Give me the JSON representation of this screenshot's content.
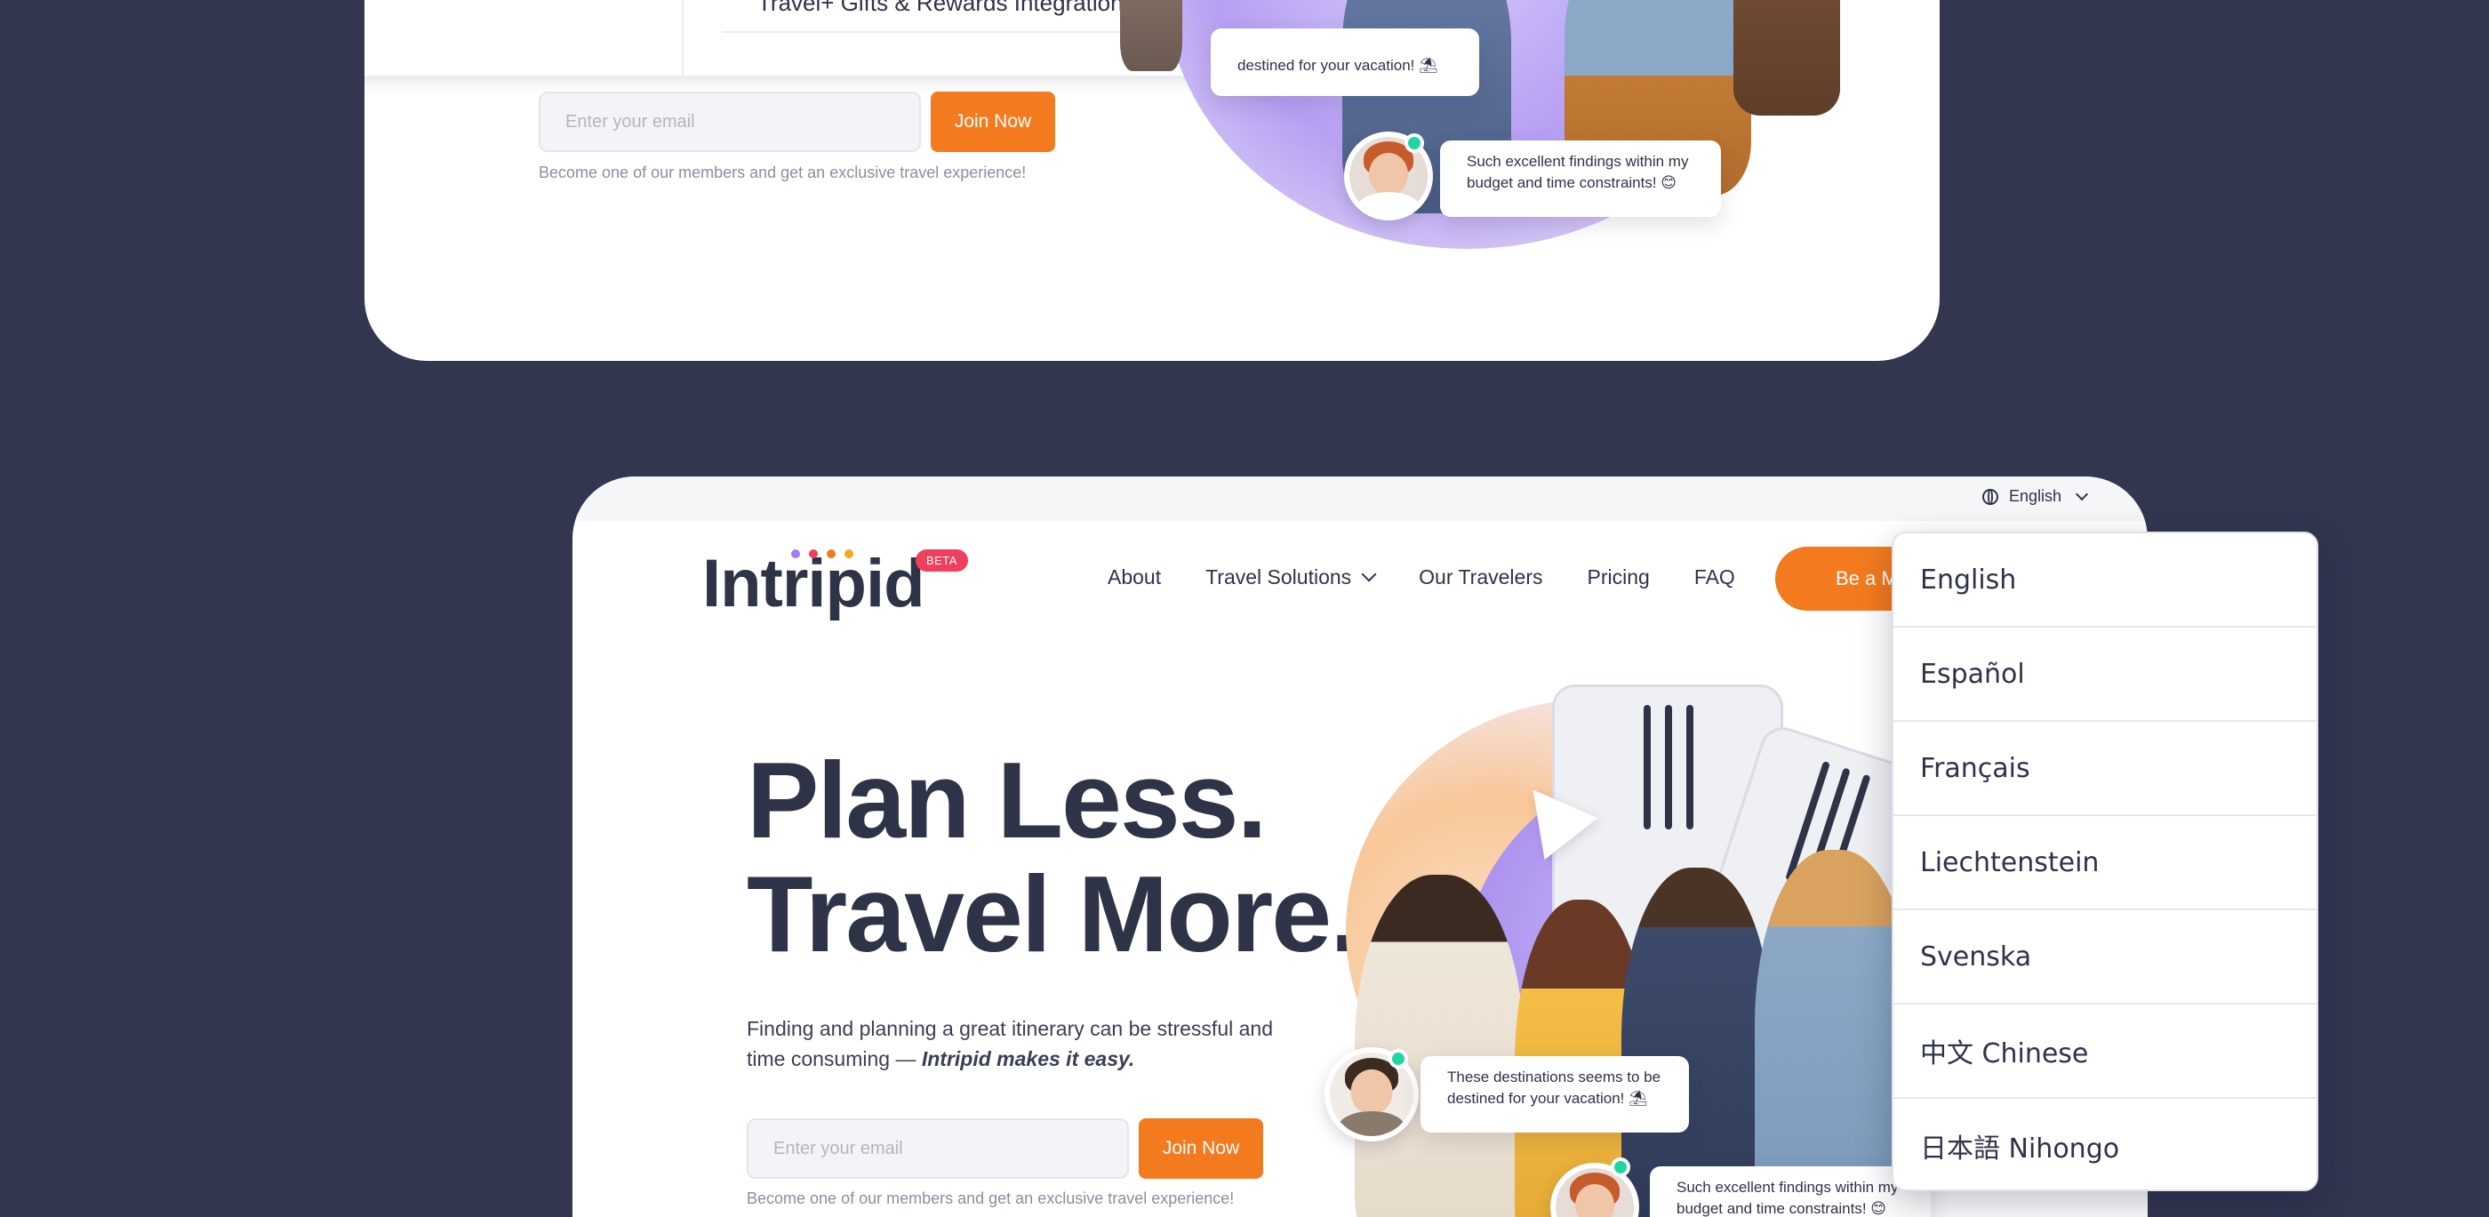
{
  "top_card": {
    "menu_item_label": "Travel+ Gifts & Rewards Integration",
    "email_placeholder": "Enter your email",
    "join_label": "Join Now",
    "member_note": "Become one of our members and get an exclusive travel experience!",
    "bubble_1": "destined for your vacation! ⛱",
    "bubble_2_line1": "Such excellent findings within my",
    "bubble_2_line2": "budget and time constraints! 😊"
  },
  "header": {
    "language_label": "English",
    "logo_text": "Intripid",
    "beta_badge": "BETA",
    "nav": {
      "about": "About",
      "travel_solutions": "Travel Solutions",
      "our_travelers": "Our Travelers",
      "pricing": "Pricing",
      "faq": "FAQ"
    },
    "member_button": "Be a Member"
  },
  "hero": {
    "title_line1": "Plan Less.",
    "title_line2": "Travel More.",
    "sub_text": "Finding and planning a great itinerary can be stressful and time consuming — ",
    "sub_emphasis": "Intripid makes it easy.",
    "email_placeholder": "Enter your email",
    "join_label": "Join Now",
    "member_note": "Become one of our members and get an exclusive travel experience!",
    "bubble_1_line1": "These destinations seems to be",
    "bubble_1_line2": "destined for your vacation! ⛱",
    "bubble_2_line1": "Such excellent findings within my",
    "bubble_2_line2": "budget and time constraints! 😊"
  },
  "language_menu": {
    "options": [
      "English",
      "Español",
      "Français",
      "Liechtenstein",
      "Svenska",
      "中文 Chinese",
      "日本語 Nihongo"
    ]
  },
  "colors": {
    "background": "#33364f",
    "accent_orange": "#f47a1f",
    "beta_red": "#ef3f5c",
    "online_green": "#1ed6a2",
    "text_dark": "#2e3348"
  }
}
